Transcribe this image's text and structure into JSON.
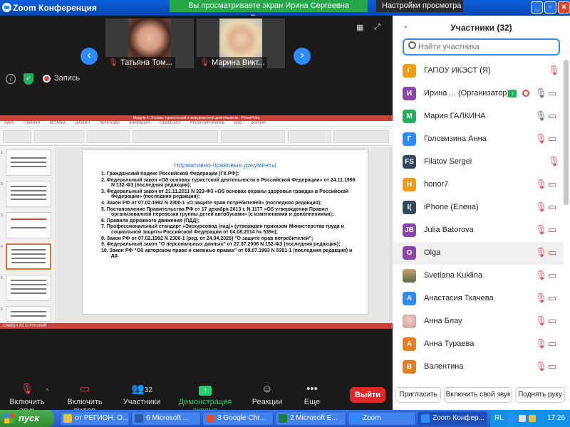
{
  "window": {
    "title": "Zoom Конференция",
    "viewing_banner": "Вы просматриваете экран Ирина Сергеевна Соломина",
    "view_options": "Настройки просмотра"
  },
  "video_strip": {
    "tiles": [
      {
        "name": "Татьяна Том..."
      },
      {
        "name": "Марина Викт..."
      }
    ],
    "recording_label": "Запись"
  },
  "shared_screen": {
    "app_title": "Модуль 4. Основы турагентской и экскурсионной деятельности - PowerPoint",
    "tabs": [
      "ФАЙЛ",
      "ГЛАВНАЯ",
      "ВСТАВКА",
      "ДИЗАЙН",
      "ПЕРЕХОДЫ",
      "АНИМАЦИЯ",
      "СЛАЙД-ШОУ",
      "РЕЦЕНЗИРОВАНИЕ",
      "ВИД",
      "ФОРМАТ"
    ],
    "status": "СЛАЙД 4 ИЗ 12   РУССКИЙ",
    "slide_title": "Нормативно-правовые документы",
    "slide_items": [
      "1.  Гражданский Кодекс Российской Федерации (ГК РФ);",
      "2.  Федеральный закон «Об основах туристской деятельности в Российской Федерации» от 24.11.1996 N 132-ФЗ (последняя редакция);",
      "3.  Федеральный закон от 21.11.2011 N 323-ФЗ «Об основах охраны здоровья граждан в Российской Федерации» (последняя редакция);",
      "4.  Закон РФ от 07.02.1992 N 2300-1 «О защите прав потребителей» (последняя редакция);",
      "5.  Постановление Правительства РФ от 17 декабря 2013 г. N 1177 «Об утверждении Правил организованной перевозки группы детей автобусами» (с изменениями и дополнениями);",
      "6.  Правила дорожного движения (ПДД);",
      "7.  Профессиональный стандарт «Экскурсовод (гид)» (утвержден приказом Министерства труда и социальной защиты Российской Федерации от 04.08.2014 № 539н);",
      "8.  Закон РФ от 07.02.1992 N 2300-1 (ред. от 24.04.2020) \"О защите прав потребителей\";",
      "9.  Федеральный закон \"О персональных данных\" от 27.07.2006 N 152-ФЗ (последняя редакция);",
      "10. Закон РФ \"Об авторском праве и смежных правах\" от 09.07.1993 N 5351-1 (последняя редакция) и др."
    ]
  },
  "toolbar": {
    "audio": "Включить звук",
    "video": "Включить видео",
    "participants": "Участники",
    "participants_count": "32",
    "share": "Демонстрация экрана",
    "reactions": "Реакции",
    "more": "Еще",
    "leave": "Выйти"
  },
  "panel": {
    "title": "Участники (32)",
    "search_placeholder": "Найти участника",
    "host_suffix": "(Организатор)",
    "participants": [
      {
        "initial": "Г",
        "name": "ГАПОУ ИКЭСТ (Я)",
        "color": "#f39c12",
        "mic": "off",
        "video": "none"
      },
      {
        "initial": "И",
        "name": "Ирина ...",
        "color": "#8e44ad",
        "mic": "on",
        "video": "on",
        "host": true
      },
      {
        "initial": "М",
        "name": "Мария ГАЛКИНА",
        "color": "#27ae60",
        "mic": "on",
        "video": "off"
      },
      {
        "initial": "Г",
        "name": "Головизина Анна",
        "color": "#2d8cff",
        "mic": "off",
        "video": "off"
      },
      {
        "initial": "FS",
        "name": "Filatov Sergei",
        "color": "#34495e",
        "mic": "off",
        "video": "none"
      },
      {
        "initial": "H",
        "name": "honor7",
        "color": "#f39c12",
        "mic": "off",
        "video": "off"
      },
      {
        "initial": "I(",
        "name": "iPhone (Елена)",
        "color": "#34495e",
        "mic": "off",
        "video": "off"
      },
      {
        "initial": "JB",
        "name": "Julia Batorova",
        "color": "#8e44ad",
        "mic": "off",
        "video": "off"
      },
      {
        "initial": "O",
        "name": "Olga",
        "color": "#8e44ad",
        "mic": "off",
        "video": "off",
        "highlight": true
      },
      {
        "initial": "",
        "name": "Svetlana Kuklina",
        "color": "#7a8a6a",
        "mic": "off",
        "video": "off"
      },
      {
        "initial": "А",
        "name": "Анастасия Ткачева",
        "color": "#2d8cff",
        "mic": "off",
        "video": "off"
      },
      {
        "initial": "",
        "name": "Анна Блау",
        "color": "#d8a8a0",
        "mic": "off",
        "video": "off"
      },
      {
        "initial": "А",
        "name": "Анна Тураева",
        "color": "#e67e22",
        "mic": "off",
        "video": "off"
      },
      {
        "initial": "В",
        "name": "Валентина",
        "color": "#e67e22",
        "mic": "off",
        "video": "off"
      }
    ],
    "footer": {
      "invite": "Пригласить",
      "unmute_me": "Включить свой звук",
      "raise_hand": "Поднять руку"
    }
  },
  "taskbar": {
    "start": "пуск",
    "items": [
      {
        "label": "от РЕГИОН. О...",
        "color": "#e8c33a"
      },
      {
        "label": "6 Microsoft ...",
        "color": "#2a5caa"
      },
      {
        "label": "3 Google Chr...",
        "color": "#e84a2a"
      },
      {
        "label": "2 Microsoft E...",
        "color": "#1e7e3e"
      },
      {
        "label": "Zoom",
        "color": "#2d8cff"
      },
      {
        "label": "Zoom Конфер...",
        "color": "#2d8cff"
      }
    ],
    "lang": "RL",
    "clock": "17:26"
  }
}
